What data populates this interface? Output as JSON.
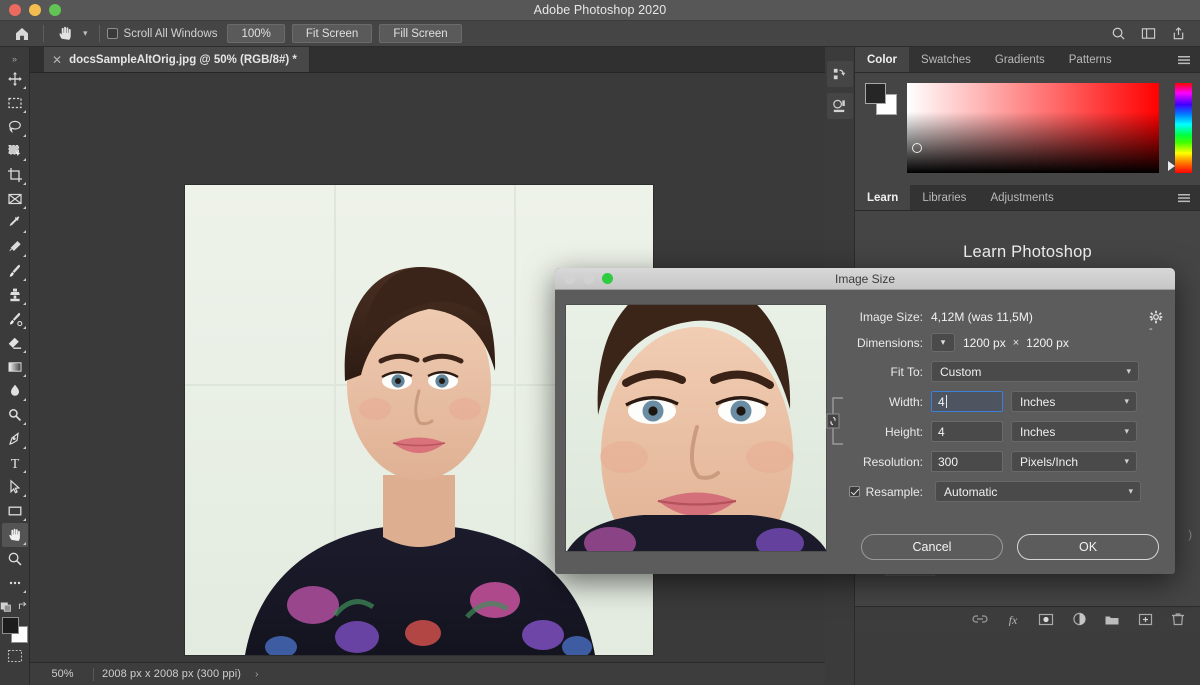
{
  "window": {
    "title": "Adobe Photoshop 2020",
    "traffic_lights": [
      "close",
      "minimize",
      "zoom"
    ]
  },
  "options_bar": {
    "home_icon": "home-icon",
    "tool_icon": "hand-tool-icon",
    "tool_caret": "chevron-down-icon",
    "scroll_all_windows": {
      "label": "Scroll All Windows",
      "checked": false
    },
    "buttons": [
      {
        "label": "100%",
        "name": "zoom-100-button"
      },
      {
        "label": "Fit Screen",
        "name": "fit-screen-button"
      },
      {
        "label": "Fill Screen",
        "name": "fill-screen-button"
      }
    ],
    "right_icons": [
      "search-icon",
      "workspace-icon",
      "share-icon"
    ]
  },
  "toolbar": {
    "overflow": "»",
    "tools": [
      {
        "name": "move-tool",
        "icon": "move-icon"
      },
      {
        "name": "marquee-tool",
        "icon": "rectangular-marquee-icon"
      },
      {
        "name": "lasso-tool",
        "icon": "lasso-icon"
      },
      {
        "name": "quick-selection-tool",
        "icon": "quick-selection-icon"
      },
      {
        "name": "crop-tool",
        "icon": "crop-icon"
      },
      {
        "name": "frame-tool",
        "icon": "frame-icon"
      },
      {
        "name": "eyedropper-tool",
        "icon": "eyedropper-icon"
      },
      {
        "name": "healing-brush-tool",
        "icon": "healing-brush-icon"
      },
      {
        "name": "brush-tool",
        "icon": "brush-icon"
      },
      {
        "name": "clone-stamp-tool",
        "icon": "clone-stamp-icon"
      },
      {
        "name": "history-brush-tool",
        "icon": "history-brush-icon"
      },
      {
        "name": "eraser-tool",
        "icon": "eraser-icon"
      },
      {
        "name": "gradient-tool",
        "icon": "gradient-icon"
      },
      {
        "name": "blur-tool",
        "icon": "blur-droplet-icon"
      },
      {
        "name": "dodge-tool",
        "icon": "dodge-icon"
      },
      {
        "name": "pen-tool",
        "icon": "pen-icon"
      },
      {
        "name": "type-tool",
        "icon": "type-t-icon"
      },
      {
        "name": "path-selection-tool",
        "icon": "path-arrow-icon"
      },
      {
        "name": "rectangle-tool",
        "icon": "rectangle-shape-icon"
      },
      {
        "name": "hand-tool",
        "icon": "hand-icon",
        "active": true
      },
      {
        "name": "zoom-tool",
        "icon": "magnifier-icon"
      },
      {
        "name": "more-tools",
        "icon": "ellipsis-icon"
      }
    ],
    "quick_mask_icon": "quick-mask-icon",
    "swap_colors_icon": "swap-colors-icon",
    "foreground_color": "#262626",
    "background_color": "#ffffff"
  },
  "document": {
    "tab_label": "docsSampleAltOrig.jpg @ 50% (RGB/8#) *",
    "tab_close_icon": "close-icon",
    "expand_icon": "chevrons-right-icon"
  },
  "status_bar": {
    "zoom": "50%",
    "dimensions": "2008 px x 2008 px (300 ppi)",
    "arrow": "›"
  },
  "dock": {
    "icons": [
      "history-panel-icon",
      "properties-panel-icon"
    ]
  },
  "color_panel": {
    "tabs": [
      {
        "label": "Color",
        "active": true
      },
      {
        "label": "Swatches",
        "active": false
      },
      {
        "label": "Gradients",
        "active": false
      },
      {
        "label": "Patterns",
        "active": false
      }
    ],
    "menu_icon": "panel-menu-icon",
    "foreground_color": "#262626",
    "background_color": "#ffffff",
    "spectrum_hue": "#ff0000"
  },
  "learn_panel": {
    "tabs": [
      {
        "label": "Learn",
        "active": true
      },
      {
        "label": "Libraries",
        "active": false
      },
      {
        "label": "Adjustments",
        "active": false
      }
    ],
    "menu_icon": "panel-menu-icon",
    "heading": "Learn Photoshop"
  },
  "layers_footer": {
    "icons": [
      "link-layers-icon",
      "layer-style-fx-icon",
      "layer-mask-icon",
      "adjustment-layer-icon",
      "new-group-icon",
      "new-layer-icon",
      "delete-layer-icon"
    ]
  },
  "dialog": {
    "title": "Image Size",
    "traffic_lights": [
      "close",
      "minimize",
      "zoom"
    ],
    "gear_icon": "gear-icon",
    "fields": {
      "image_size_label": "Image Size:",
      "image_size_value": "4,12M (was 11,5M)",
      "dimensions_label": "Dimensions:",
      "dimensions_chevron_icon": "chevron-down-icon",
      "dimensions_width": "1200 px",
      "dimensions_separator": "×",
      "dimensions_height": "1200 px",
      "fit_to_label": "Fit To:",
      "fit_to_value": "Custom",
      "width_label": "Width:",
      "width_value": "4",
      "width_unit": "Inches",
      "height_label": "Height:",
      "height_value": "4",
      "height_unit": "Inches",
      "resolution_label": "Resolution:",
      "resolution_value": "300",
      "resolution_unit": "Pixels/Inch",
      "resample_label": "Resample:",
      "resample_checked": true,
      "resample_value": "Automatic",
      "constrain_icon": "link-chain-icon"
    },
    "buttons": [
      {
        "label": "Cancel",
        "name": "cancel-button"
      },
      {
        "label": "OK",
        "name": "ok-button"
      }
    ]
  }
}
